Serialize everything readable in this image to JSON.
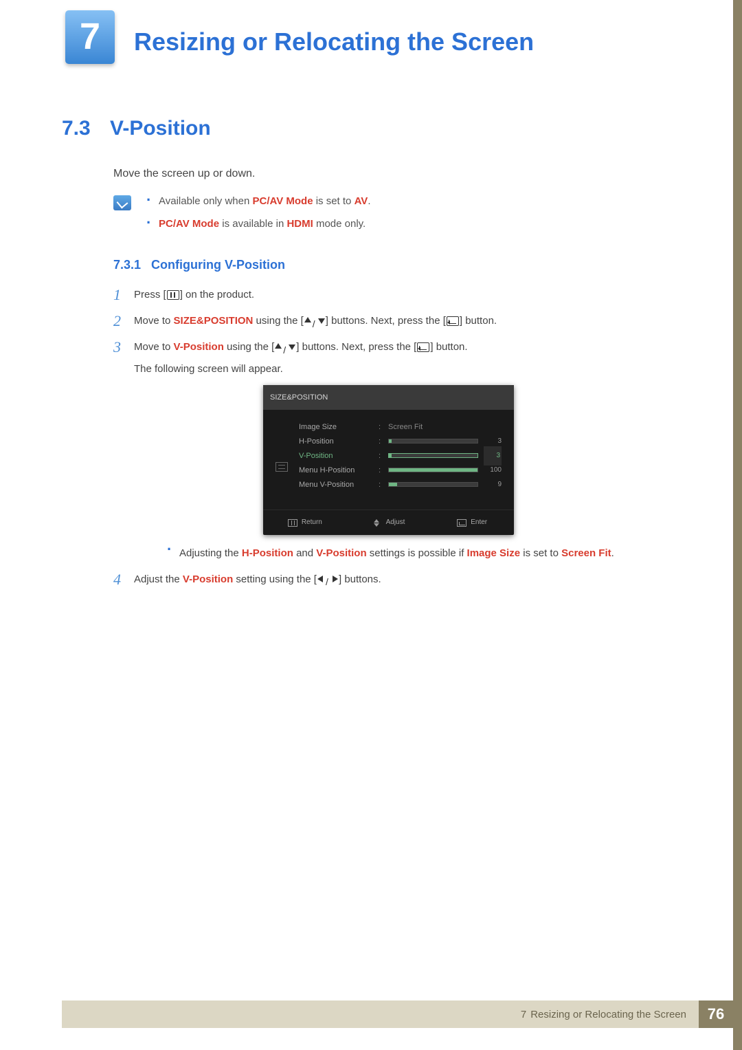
{
  "chapter": {
    "number": "7",
    "title": "Resizing or Relocating the Screen"
  },
  "section": {
    "number": "7.3",
    "title": "V-Position",
    "intro": "Move the screen up or down."
  },
  "notes": {
    "n1_a": "Available only when ",
    "n1_b": "PC/AV Mode",
    "n1_c": " is set to ",
    "n1_d": "AV",
    "n1_e": ".",
    "n2_a": "PC/AV Mode",
    "n2_b": " is available in ",
    "n2_c": "HDMI",
    "n2_d": " mode only."
  },
  "subsection": {
    "number": "7.3.1",
    "title": "Configuring V-Position"
  },
  "steps": {
    "s1_a": "Press [",
    "s1_b": "] on the product.",
    "s2_a": "Move to ",
    "s2_b": "SIZE&POSITION",
    "s2_c": " using the [",
    "s2_d": "] buttons. Next, press the [",
    "s2_e": "] button.",
    "s3_a": "Move to ",
    "s3_b": "V-Position",
    "s3_c": " using the [",
    "s3_d": "] buttons. Next, press the [",
    "s3_e": "] button.",
    "s3_f": "The following screen will appear.",
    "s3_note_a": "Adjusting the ",
    "s3_note_b": "H-Position",
    "s3_note_c": " and ",
    "s3_note_d": "V-Position",
    "s3_note_e": " settings is possible if ",
    "s3_note_f": "Image Size",
    "s3_note_g": " is set to ",
    "s3_note_h": "Screen Fit",
    "s3_note_i": ".",
    "s4_a": "Adjust the ",
    "s4_b": "V-Position",
    "s4_c": " setting using the [",
    "s4_d": "] buttons."
  },
  "osd": {
    "title": "SIZE&POSITION",
    "rows": {
      "r1_label": "Image Size",
      "r1_value": "Screen Fit",
      "r2_label": "H-Position",
      "r2_value": "3",
      "r3_label": "V-Position",
      "r3_value": "3",
      "r4_label": "Menu H-Position",
      "r4_value": "100",
      "r5_label": "Menu V-Position",
      "r5_value": "9"
    },
    "foot": {
      "return": "Return",
      "adjust": "Adjust",
      "enter": "Enter"
    }
  },
  "footer": {
    "chapter_num": "7",
    "chapter_title": "Resizing or Relocating the Screen",
    "page": "76"
  }
}
